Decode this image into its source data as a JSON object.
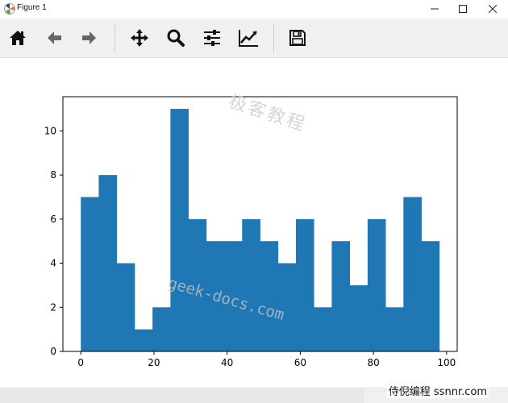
{
  "window": {
    "title": "Figure 1",
    "controls": [
      "minimize",
      "maximize",
      "close"
    ]
  },
  "toolbar": {
    "buttons": [
      {
        "name": "home",
        "icon": "home-icon"
      },
      {
        "name": "back",
        "icon": "arrow-left-icon"
      },
      {
        "name": "forward",
        "icon": "arrow-right-icon"
      },
      {
        "name": "pan",
        "icon": "move-arrows-icon"
      },
      {
        "name": "zoom",
        "icon": "magnifier-icon"
      },
      {
        "name": "configure-subplots",
        "icon": "sliders-icon"
      },
      {
        "name": "edit-axis",
        "icon": "line-chart-icon"
      },
      {
        "name": "save",
        "icon": "floppy-disk-icon"
      }
    ]
  },
  "watermarks": {
    "top": "极客教程",
    "middle": "geek-docs.com"
  },
  "brand": "侍倪编程 ssnnr.com",
  "chart_data": {
    "type": "bar",
    "title": "",
    "xlabel": "",
    "ylabel": "",
    "bar_color": "#1f77b4",
    "bins": [
      {
        "x0": 0.0,
        "x1": 4.9,
        "value": 7
      },
      {
        "x0": 4.9,
        "x1": 9.8,
        "value": 8
      },
      {
        "x0": 9.8,
        "x1": 14.7,
        "value": 4
      },
      {
        "x0": 14.7,
        "x1": 19.6,
        "value": 1
      },
      {
        "x0": 19.6,
        "x1": 24.5,
        "value": 2
      },
      {
        "x0": 24.5,
        "x1": 29.4,
        "value": 11
      },
      {
        "x0": 29.4,
        "x1": 34.3,
        "value": 6
      },
      {
        "x0": 34.3,
        "x1": 39.2,
        "value": 5
      },
      {
        "x0": 39.2,
        "x1": 44.1,
        "value": 5
      },
      {
        "x0": 44.1,
        "x1": 49.0,
        "value": 6
      },
      {
        "x0": 49.0,
        "x1": 53.9,
        "value": 5
      },
      {
        "x0": 53.9,
        "x1": 58.8,
        "value": 4
      },
      {
        "x0": 58.8,
        "x1": 63.7,
        "value": 6
      },
      {
        "x0": 63.7,
        "x1": 68.6,
        "value": 2
      },
      {
        "x0": 68.6,
        "x1": 73.5,
        "value": 5
      },
      {
        "x0": 73.5,
        "x1": 78.4,
        "value": 3
      },
      {
        "x0": 78.4,
        "x1": 83.3,
        "value": 6
      },
      {
        "x0": 83.3,
        "x1": 88.2,
        "value": 2
      },
      {
        "x0": 88.2,
        "x1": 93.1,
        "value": 7
      },
      {
        "x0": 93.1,
        "x1": 98.0,
        "value": 5
      }
    ],
    "xlim": [
      -4.9,
      102.9
    ],
    "ylim": [
      0,
      11.55
    ],
    "xticks": [
      0,
      20,
      40,
      60,
      80,
      100
    ],
    "yticks": [
      0,
      2,
      4,
      6,
      8,
      10
    ],
    "grid": false,
    "legend": "none"
  }
}
